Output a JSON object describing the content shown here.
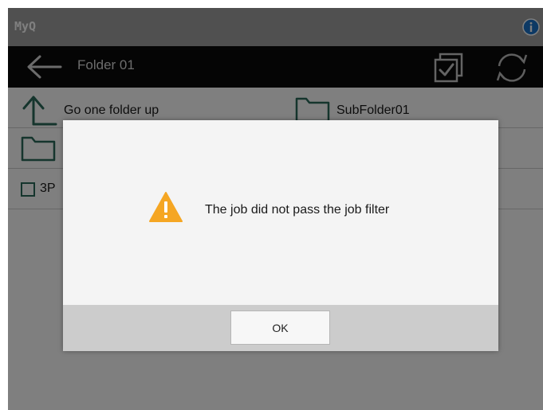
{
  "app": {
    "name": "MyQ"
  },
  "header": {
    "title": "Folder 01"
  },
  "icons": {
    "info": "info-icon",
    "back": "back-arrow-icon",
    "select_all": "checkbox-select-icon",
    "refresh": "refresh-icon",
    "folder_up": "folder-up-arrow-icon",
    "folder": "folder-icon",
    "file": "file-checkbox-icon",
    "warning": "warning-icon"
  },
  "list": {
    "go_up_label": "Go one folder up",
    "subfolder_label": "SubFolder01",
    "file_label_partial": "3P"
  },
  "dialog": {
    "message": "The job did not pass the job filter",
    "ok_label": "OK"
  },
  "colors": {
    "brand_bar": "#a1a1a1",
    "title_bar": "#0b0b0b",
    "info_blue": "#1a73c8",
    "folder_green": "#2b6b5a",
    "warning_orange": "#f5a623"
  }
}
